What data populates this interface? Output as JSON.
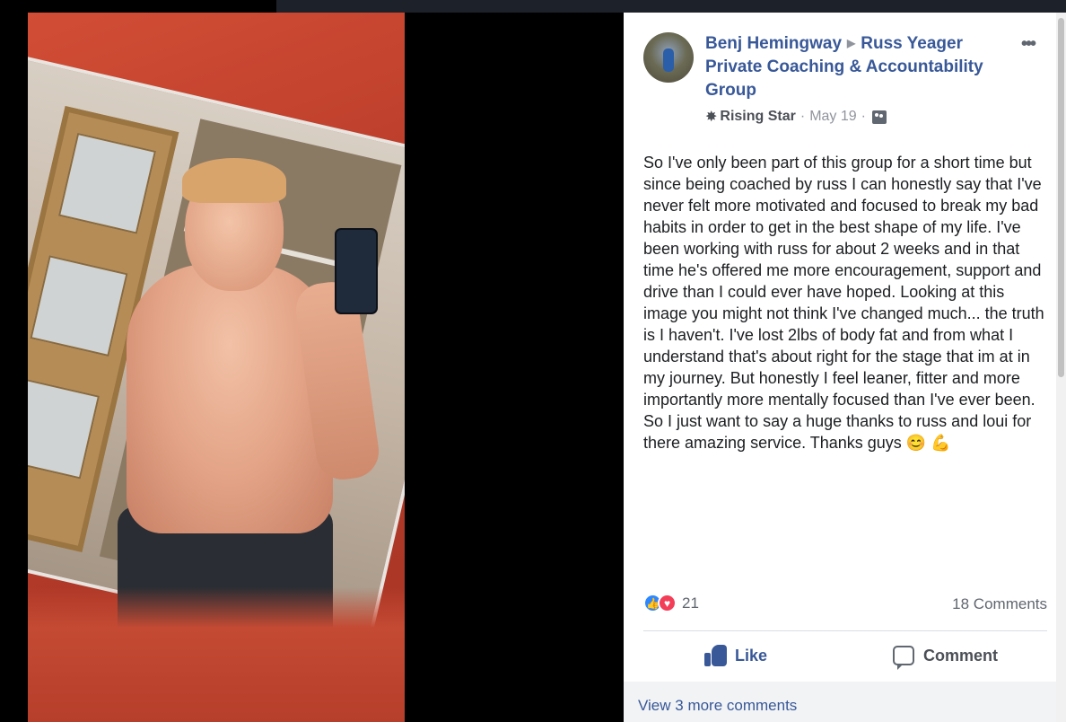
{
  "post": {
    "author": "Benj Hemingway",
    "group": "Russ Yeager Private Coaching & Accountability Group",
    "badge": "Rising Star",
    "date": "May 19",
    "body": "So I've only been part of this group for a short time but since being coached by russ I can honestly say that I've never felt more motivated and focused to break my bad habits in order to get in the best shape of my life. I've been working with russ for about 2 weeks and in that time he's offered me more encouragement, support and drive than I could ever have hoped. Looking at this image you might not think I've changed much... the truth is I haven't. I've lost 2lbs of body fat and from what I understand that's about right for the stage that im at in my journey. But honestly I feel leaner, fitter and more importantly more mentally focused than I've ever been. So I just want to say a huge thanks to russ and loui for there amazing service. Thanks guys",
    "emoji_1": "😊",
    "emoji_2": "💪"
  },
  "stats": {
    "reaction_count": "21",
    "comments": "18 Comments"
  },
  "actions": {
    "like": "Like",
    "comment": "Comment",
    "view_more": "View 3 more comments"
  },
  "icons": {
    "more": "more-options-icon",
    "badge": "rising-star-icon",
    "audience": "group-audience-icon",
    "like_reaction": "like-reaction-icon",
    "love_reaction": "love-reaction-icon"
  },
  "colors": {
    "link": "#385898",
    "like_blue": "#2d88ff",
    "love_red": "#f33e58"
  }
}
